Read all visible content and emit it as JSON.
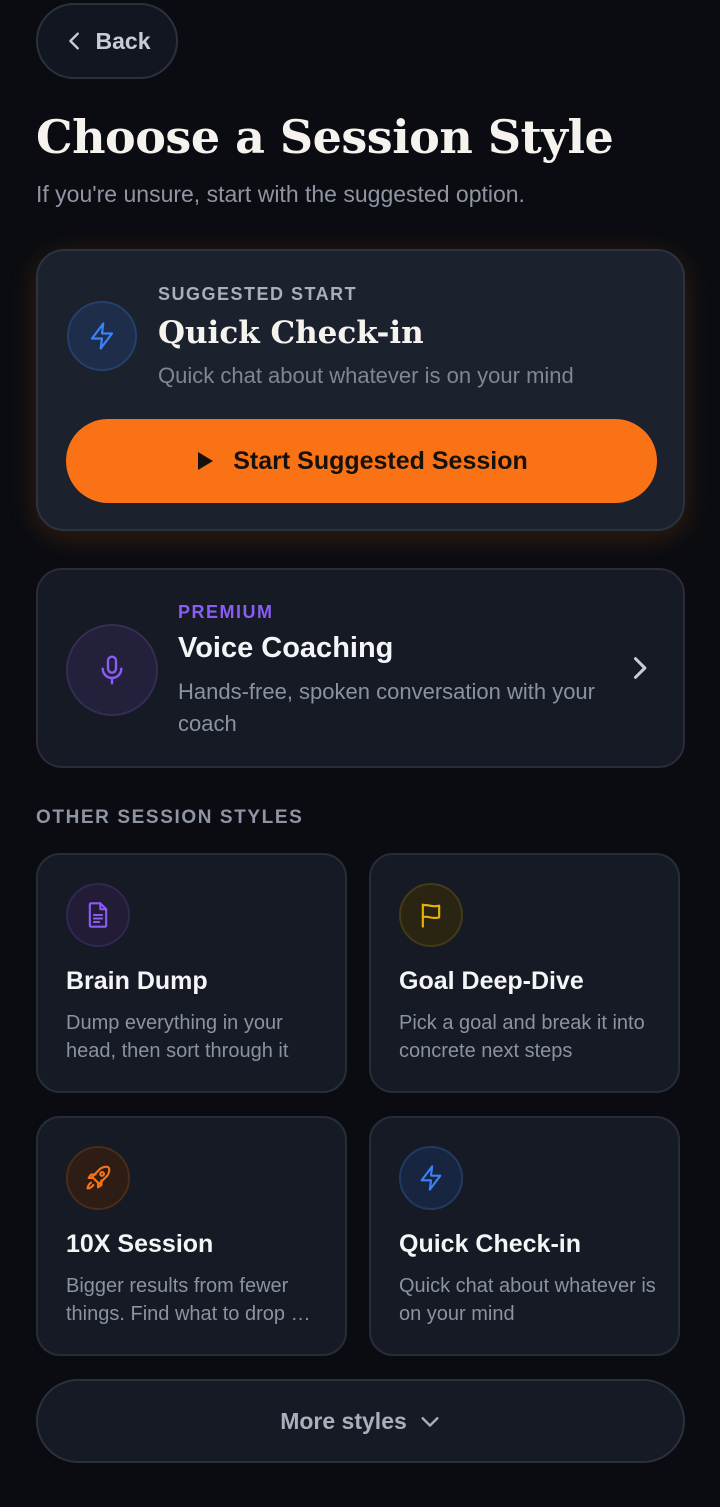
{
  "header": {
    "back_label": "Back",
    "title": "Choose a Session Style",
    "subtitle": "If you're unsure, start with the suggested option."
  },
  "suggested": {
    "eyebrow": "SUGGESTED START",
    "title": "Quick Check-in",
    "description": "Quick chat about whatever is on your mind",
    "button_label": "Start Suggested Session",
    "icon": "lightning-icon"
  },
  "premium": {
    "eyebrow": "PREMIUM",
    "title": "Voice Coaching",
    "description": "Hands-free, spoken conversation with your coach",
    "icon": "microphone-icon"
  },
  "other_styles": {
    "label": "OTHER SESSION STYLES",
    "cards": [
      {
        "title": "Brain Dump",
        "description": "Dump everything in your head, then sort through it",
        "icon": "document-icon"
      },
      {
        "title": "Goal Deep-Dive",
        "description": "Pick a goal and break it into concrete next steps",
        "icon": "flag-icon"
      },
      {
        "title": "10X Session",
        "description": "Bigger results from fewer things. Find what to drop …",
        "icon": "rocket-icon"
      },
      {
        "title": "Quick Check-in",
        "description": "Quick chat about whatever is on your mind",
        "icon": "lightning-icon"
      }
    ]
  },
  "more_styles_label": "More styles",
  "colors": {
    "accent": "#f97316",
    "premium": "#8b5cf6",
    "background": "#0a0c11",
    "card": "#151a24"
  }
}
